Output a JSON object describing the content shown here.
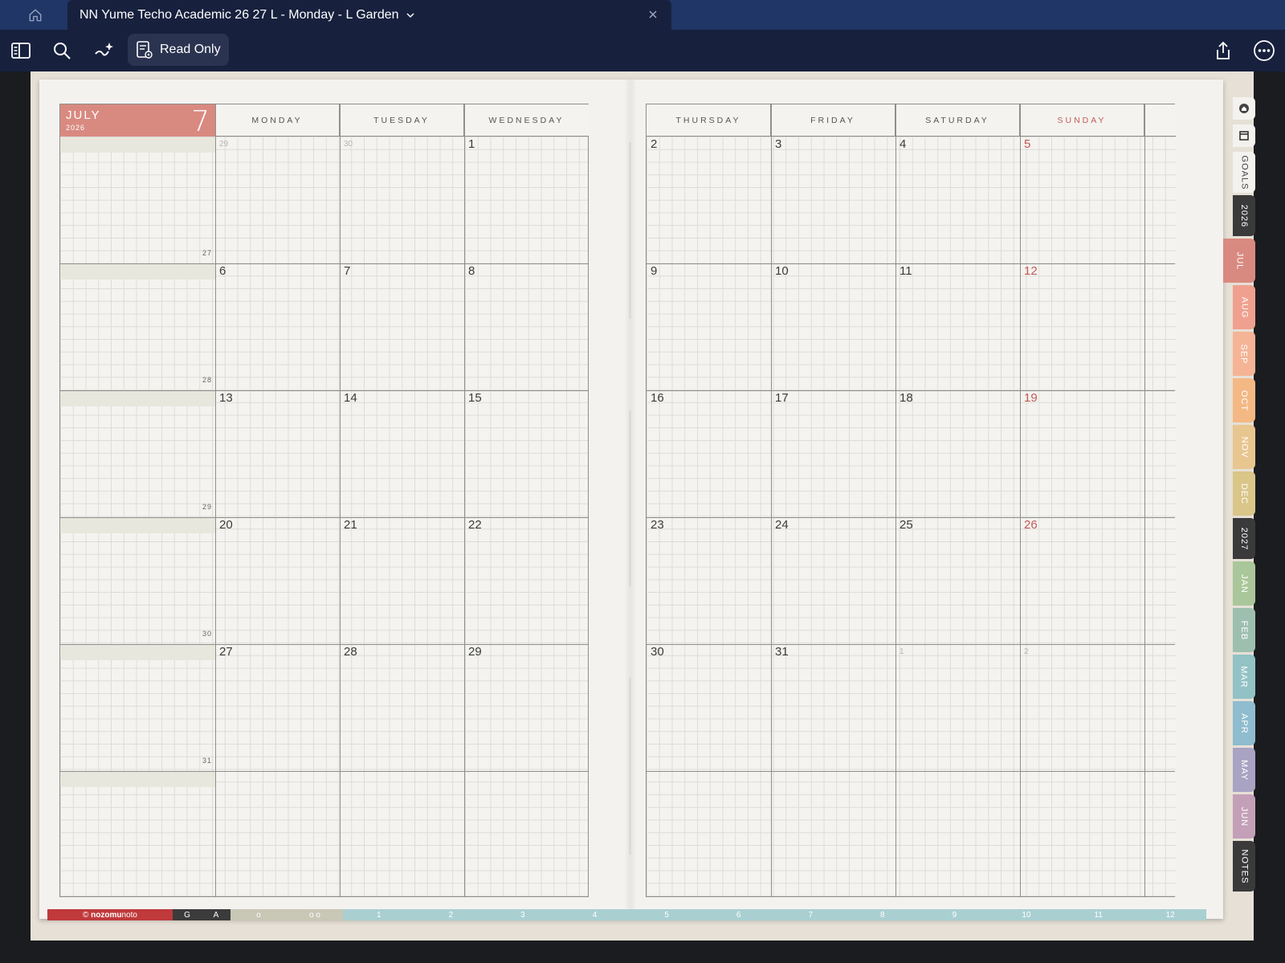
{
  "tabbar": {
    "home_icon": "home-icon",
    "document_title": "NN Yume Techo Academic 26 27 L - Monday - L Garden",
    "chevron_icon": "chevron-down-icon",
    "close_icon": "close-icon"
  },
  "toolbar": {
    "read_only_label": "Read Only",
    "icons": [
      "sidebar-icon",
      "search-icon",
      "sparkle-pen-icon",
      "read-only-icon",
      "share-icon",
      "more-icon"
    ]
  },
  "planner": {
    "month_name": "JULY",
    "year": "2026",
    "month_number": "7",
    "left_days": [
      "MONDAY",
      "TUESDAY",
      "WEDNESDAY"
    ],
    "right_days": [
      "THURSDAY",
      "FRIDAY",
      "SATURDAY",
      "SUNDAY"
    ],
    "week_numbers": [
      "27",
      "28",
      "29",
      "30",
      "31"
    ],
    "weeks": [
      [
        "29",
        "30",
        "1",
        "2",
        "3",
        "4",
        "5"
      ],
      [
        "6",
        "7",
        "8",
        "9",
        "10",
        "11",
        "12"
      ],
      [
        "13",
        "14",
        "15",
        "16",
        "17",
        "18",
        "19"
      ],
      [
        "20",
        "21",
        "22",
        "23",
        "24",
        "25",
        "26"
      ],
      [
        "27",
        "28",
        "29",
        "30",
        "31",
        "1",
        "2"
      ]
    ],
    "sunday_color": "#c45a5a",
    "accent_color": "#d98a80"
  },
  "side_tabs": [
    {
      "label": "GOALS",
      "color": "#f3f2ef",
      "text_color": "#444"
    },
    {
      "label": "2026",
      "color": "#3a3a3a",
      "text_color": "#ffffff"
    },
    {
      "label": "JUL",
      "color": "#d98a80",
      "text_color": "#ffffff"
    },
    {
      "label": "AUG",
      "color": "#f0a08f",
      "text_color": "#ffffff"
    },
    {
      "label": "SEP",
      "color": "#f5b496",
      "text_color": "#ffffff"
    },
    {
      "label": "OCT",
      "color": "#f4b884",
      "text_color": "#ffffff"
    },
    {
      "label": "NOV",
      "color": "#e8c690",
      "text_color": "#ffffff"
    },
    {
      "label": "DEC",
      "color": "#d9c688",
      "text_color": "#ffffff"
    },
    {
      "label": "2027",
      "color": "#3a3a3a",
      "text_color": "#ffffff"
    },
    {
      "label": "JAN",
      "color": "#a9c79a",
      "text_color": "#ffffff"
    },
    {
      "label": "FEB",
      "color": "#9dbfb0",
      "text_color": "#ffffff"
    },
    {
      "label": "MAR",
      "color": "#92c2c5",
      "text_color": "#ffffff"
    },
    {
      "label": "APR",
      "color": "#8fbcce",
      "text_color": "#ffffff"
    },
    {
      "label": "MAY",
      "color": "#a9a3c4",
      "text_color": "#ffffff"
    },
    {
      "label": "JUN",
      "color": "#c3a0b7",
      "text_color": "#ffffff"
    },
    {
      "label": "NOTES",
      "color": "#3a3a3a",
      "text_color": "#ffffff"
    }
  ],
  "side_icons": [
    "home-icon",
    "page-icon"
  ],
  "footer": {
    "brand_prefix": "©",
    "brand_bold": "nozomu",
    "brand_rest": "noto",
    "links": [
      "G",
      "A"
    ],
    "dots": [
      "o",
      "o o"
    ],
    "months": [
      "1",
      "2",
      "3",
      "4",
      "5",
      "6",
      "7",
      "8",
      "9",
      "10",
      "11",
      "12"
    ]
  }
}
